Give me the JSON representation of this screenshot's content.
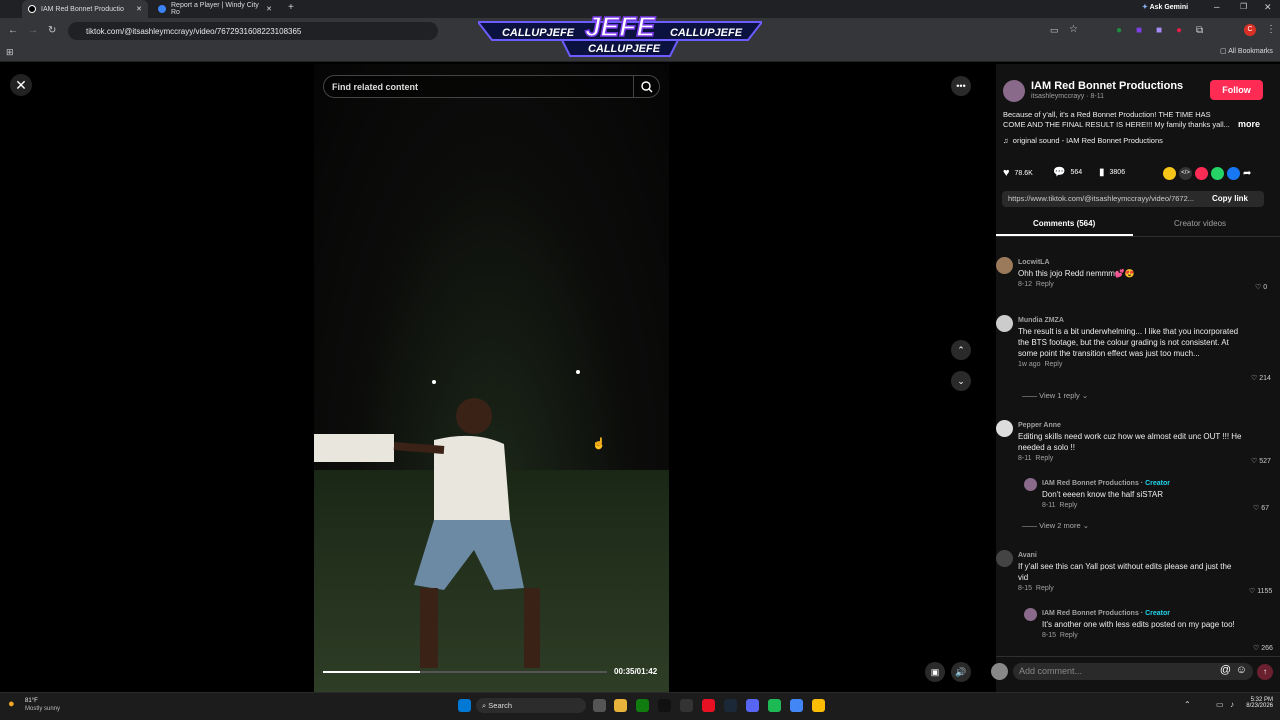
{
  "browser": {
    "tabs": [
      {
        "label": "IAM Red Bonnet Productio"
      },
      {
        "label": "Report a Player | Windy City Ro"
      }
    ],
    "url": "tiktok.com/@itsashleymccrayy/video/7672931608223108365",
    "ask_gemini": "Ask Gemini",
    "all_bookmarks": "All Bookmarks"
  },
  "overlay": {
    "top_left": "CALLUPJEFE",
    "center": "JEFE",
    "top_right": "CALLUPJEFE",
    "bottom": "CALLUPJEFE"
  },
  "video": {
    "search_placeholder": "Find related content",
    "time": "00:35/01:42",
    "progress": 0.34
  },
  "post": {
    "author": "IAM Red Bonnet Productions",
    "handle": "itsashleymccrayy · 8-11",
    "follow": "Follow",
    "caption": "Because of y'all, it's a Red Bonnet Production! THE TIME HAS COME AND THE FINAL RESULT IS HERE!!! My family thanks yall...",
    "more": "more",
    "sound": "original sound - IAM Red Bonnet Productions",
    "likes": "78.6K",
    "comments": "564",
    "saves": "3806",
    "link": "https://www.tiktok.com/@itsashleymccrayy/video/7672...",
    "copy_link": "Copy link"
  },
  "tabs": {
    "comments": "Comments (564)",
    "creator": "Creator videos"
  },
  "comments": [
    {
      "name": "LocwitLA",
      "text": "Ohh this jojo Redd nemmm💕😍",
      "date": "8-12",
      "reply": "Reply",
      "likes": "0"
    },
    {
      "name": "Mundia ZMZA",
      "text": "The result is a bit underwhelming... I like that you incorporated the BTS footage, but the colour grading is not consistent. At some point the transition effect was just too much...",
      "date": "1w ago",
      "reply": "Reply",
      "likes": "214",
      "view": "View 1 reply"
    },
    {
      "name": "Pepper Anne",
      "text": "Editing skills need work cuz how we almost edit unc OUT !!! He needed a solo !!",
      "date": "8-11",
      "reply": "Reply",
      "likes": "527"
    },
    {
      "name": "IAM Red Bonnet Productions",
      "tag": "Creator",
      "text": "Don't eeeen know the half siSTAR",
      "date": "8-11",
      "reply": "Reply",
      "likes": "67",
      "view": "View 2 more"
    },
    {
      "name": "Avani",
      "text": "If y'all see this can Yall post without edits please and just the vid",
      "date": "8-15",
      "reply": "Reply",
      "likes": "1155"
    },
    {
      "name": "IAM Red Bonnet Productions",
      "tag": "Creator",
      "text": "It's another one with less edits posted on my page too!",
      "date": "8-15",
      "reply": "Reply",
      "likes": "266"
    }
  ],
  "composer": {
    "placeholder": "Add comment..."
  },
  "taskbar": {
    "weather_temp": "81°F",
    "weather_desc": "Mostly sunny",
    "search": "Search",
    "time": "5:32 PM",
    "date": "8/23/2026"
  }
}
